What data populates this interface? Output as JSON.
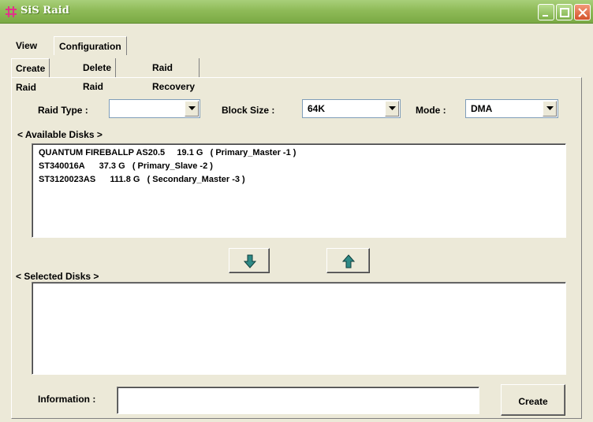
{
  "window": {
    "title": "SiS Raid",
    "controls": [
      "minimize",
      "maximize",
      "close"
    ]
  },
  "menu_tabs": [
    {
      "label": "View"
    },
    {
      "label": "Configuration"
    }
  ],
  "sub_tabs": [
    {
      "label": "Create Raid"
    },
    {
      "label": "Delete Raid"
    },
    {
      "label": "Raid Recovery"
    }
  ],
  "form": {
    "raid_type_label": "Raid Type :",
    "raid_type_value": "",
    "block_size_label": "Block Size :",
    "block_size_value": "64K",
    "mode_label": "Mode :",
    "mode_value": "DMA"
  },
  "available": {
    "label": "< Available Disks >",
    "items": [
      "QUANTUM FIREBALLP AS20.5     19.1 G   ( Primary_Master -1 )",
      "ST340016A      37.3 G   ( Primary_Slave -2 )",
      "ST3120023AS      111.8 G   ( Secondary_Master -3 )"
    ]
  },
  "selected": {
    "label": "< Selected Disks >",
    "items": []
  },
  "info": {
    "label": "Information :",
    "value": ""
  },
  "create_label": "Create",
  "colors": {
    "titlebar": "#8fbb58",
    "face": "#ece9d8",
    "arrow_icon": "#2e8a86"
  }
}
